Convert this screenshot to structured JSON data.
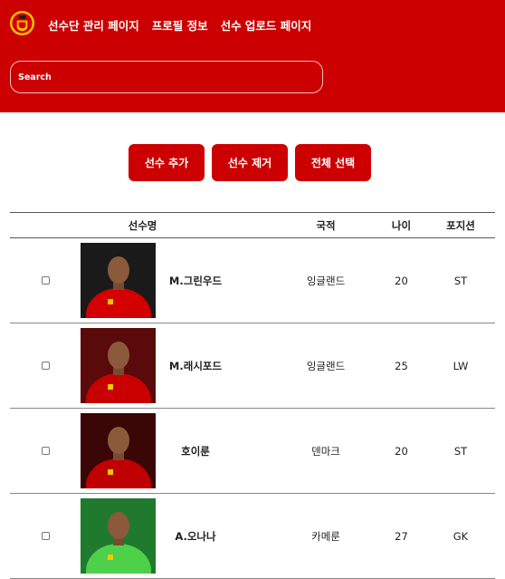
{
  "header": {
    "nav": [
      "선수단 관리 페이지",
      "프로필 정보",
      "선수 업로드 페이지"
    ],
    "search_placeholder": "Search"
  },
  "actions": {
    "add": "선수 추가",
    "remove": "선수 제거",
    "select_all": "전체 선택"
  },
  "table": {
    "headers": [
      "선수명",
      "국적",
      "나이",
      "포지션"
    ],
    "rows": [
      {
        "name": "M.그린우드",
        "nation": "잉글랜드",
        "age": "20",
        "position": "ST",
        "photo_bg": "#1a1a1a",
        "kit": "#d40000"
      },
      {
        "name": "M.래시포드",
        "nation": "잉글랜드",
        "age": "25",
        "position": "LW",
        "photo_bg": "#5a0a0a",
        "kit": "#c80000"
      },
      {
        "name": "호이룬",
        "nation": "덴마크",
        "age": "20",
        "position": "ST",
        "photo_bg": "#3a0606",
        "kit": "#c00000"
      },
      {
        "name": "A.오나나",
        "nation": "카메룬",
        "age": "27",
        "position": "GK",
        "photo_bg": "#1f7a2e",
        "kit": "#4fd04a"
      }
    ]
  },
  "colors": {
    "brand": "#cc0000"
  }
}
